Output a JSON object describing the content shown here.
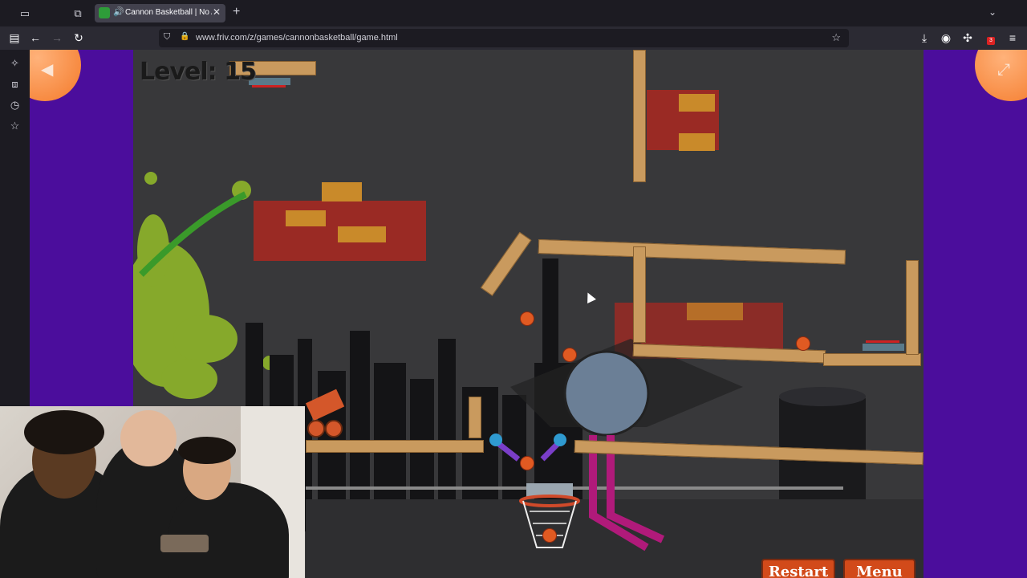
{
  "browser": {
    "tab_title": "Cannon Basketball | No Ads",
    "url": "www.friv.com/z/games/cannonbasketball/game.html",
    "extension_badge": "3"
  },
  "icons": {
    "sidebar_toggle": "sidebar-toggle-icon",
    "tab_overview": "tab-overview-icon",
    "audio": "speaker-icon",
    "close": "close-icon",
    "new_tab": "plus-icon",
    "back": "arrow-left-icon",
    "forward": "arrow-right-icon",
    "reload": "reload-icon",
    "shield": "shield-icon",
    "lock": "lock-icon",
    "bookmark": "star-icon",
    "downloads": "download-icon",
    "account": "account-icon",
    "extensions": "puzzle-icon",
    "menu": "hamburger-icon",
    "sidebar_ai": "sparkle-icon",
    "sidebar_tabs": "synced-tabs-icon",
    "sidebar_history": "history-icon",
    "sidebar_bookmarks": "bookmarks-star-icon",
    "game_back": "triangle-left-icon",
    "game_fullscreen": "fullscreen-icon"
  },
  "game": {
    "level_label": "Level: 15",
    "restart_label": "Restart",
    "menu_label": "Menu"
  },
  "colors": {
    "page_bg": "#4b0d9c",
    "game_bg": "#38383a",
    "plank": "#c99a5e",
    "button": "#d24a1a",
    "corner_button": "#f47a2a"
  }
}
